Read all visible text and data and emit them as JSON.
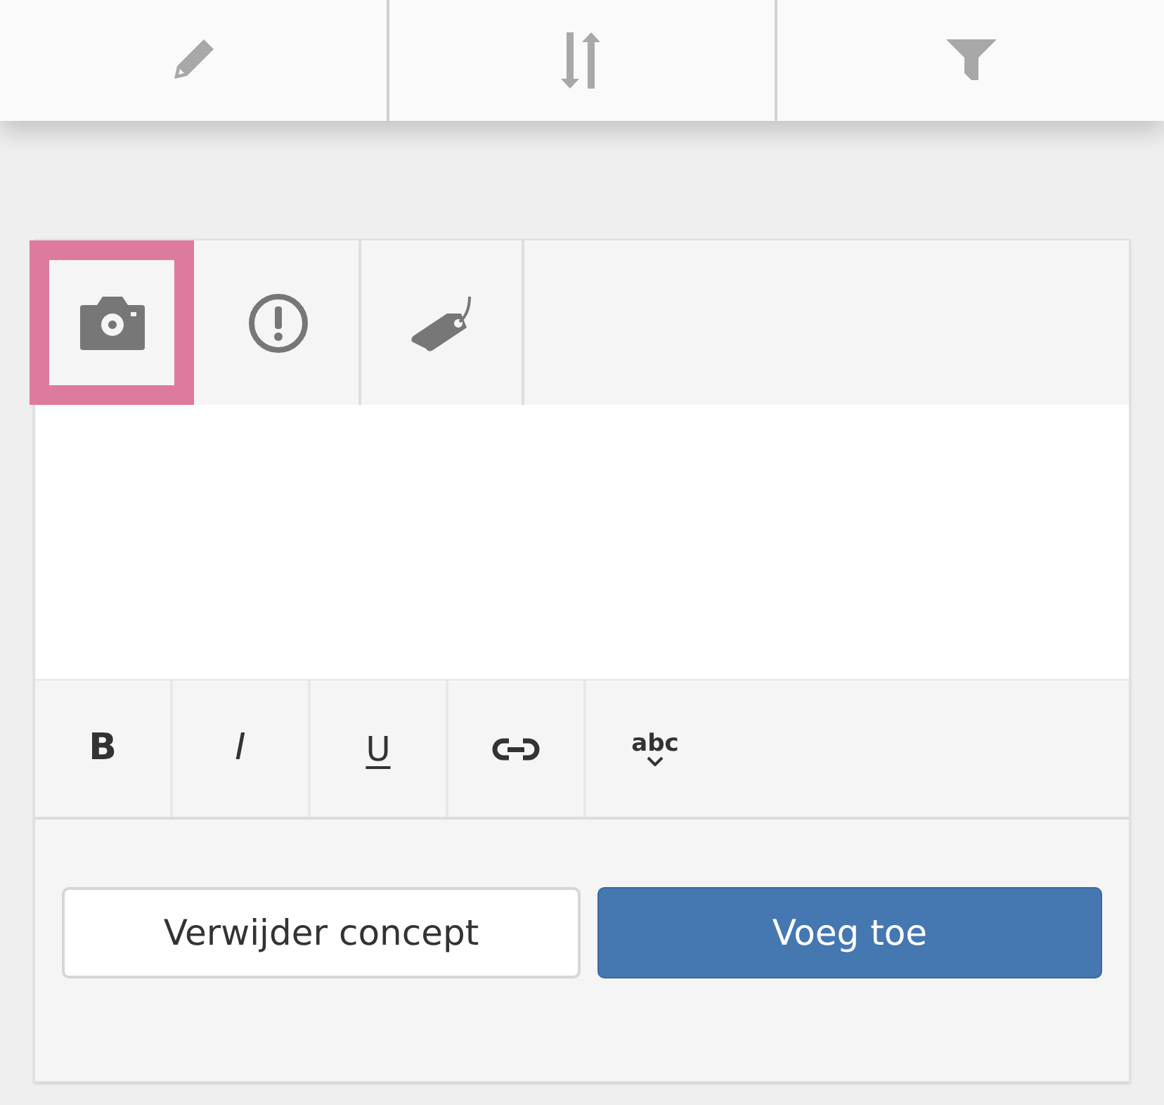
{
  "toolbar": [
    {
      "kind": "edit"
    },
    {
      "kind": "sort"
    },
    {
      "kind": "filter"
    }
  ],
  "tabs": [
    {
      "kind": "camera",
      "selected": true
    },
    {
      "kind": "alert",
      "selected": false
    },
    {
      "kind": "tag",
      "selected": false
    }
  ],
  "format_buttons": [
    {
      "kind": "bold",
      "label": "B"
    },
    {
      "kind": "italic",
      "label": "I"
    },
    {
      "kind": "underline",
      "label": "U"
    },
    {
      "kind": "link"
    },
    {
      "kind": "spellcheck",
      "label": "abc"
    }
  ],
  "buttons": [
    {
      "label": "Verwijder concept",
      "kind": "secondary"
    },
    {
      "label": "Voeg toe",
      "kind": "primary"
    }
  ]
}
